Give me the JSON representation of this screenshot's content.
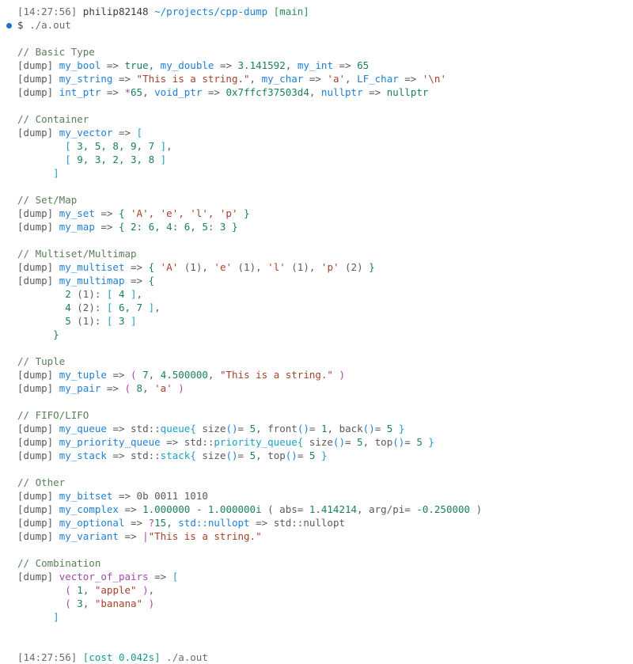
{
  "terminal": {
    "title": "terminal-session",
    "background": "#ffffff",
    "prompt": {
      "marker": "prompt-bullet",
      "marker_color": "#1a73c8",
      "timestamp": "[14:27:56]",
      "user": "philip82148",
      "path": "~/projects/cpp-dump",
      "branch": "[main]",
      "symbol": "$",
      "command": "./a.out"
    },
    "footer": {
      "timestamp": "[14:27:56]",
      "cost": "[cost 0.042s]",
      "command": "./a.out"
    },
    "sections": [
      {
        "comment": "// Basic Type",
        "lines": [
          "[dump] my_bool => true, my_double => 3.141592, my_int => 65",
          "[dump] my_string => \"This is a string.\", my_char => 'a', LF_char => '\\n'",
          "[dump] int_ptr => *65, void_ptr => 0x7ffcf37503d4, nullptr => nullptr"
        ]
      },
      {
        "comment": "// Container",
        "lines": [
          "[dump] my_vector => [",
          "        [ 3, 5, 8, 9, 7 ],",
          "        [ 9, 3, 2, 3, 8 ]",
          "      ]"
        ]
      },
      {
        "comment": "// Set/Map",
        "lines": [
          "[dump] my_set => { 'A', 'e', 'l', 'p' }",
          "[dump] my_map => { 2: 6, 4: 6, 5: 3 }"
        ]
      },
      {
        "comment": "// Multiset/Multimap",
        "lines": [
          "[dump] my_multiset => { 'A' (1), 'e' (1), 'l' (1), 'p' (2) }",
          "[dump] my_multimap => {",
          "        2 (1): [ 4 ],",
          "        4 (2): [ 6, 7 ],",
          "        5 (1): [ 3 ]",
          "      }"
        ]
      },
      {
        "comment": "// Tuple",
        "lines": [
          "[dump] my_tuple => ( 7, 4.500000, \"This is a string.\" )",
          "[dump] my_pair => ( 8, 'a' )"
        ]
      },
      {
        "comment": "// FIFO/LIFO",
        "lines": [
          "[dump] my_queue => std::queue{ size()= 5, front()= 1, back()= 5 }",
          "[dump] my_priority_queue => std::priority_queue{ size()= 5, top()= 5 }",
          "[dump] my_stack => std::stack{ size()= 5, top()= 5 }"
        ]
      },
      {
        "comment": "// Other",
        "lines": [
          "[dump] my_bitset => 0b 0011 1010",
          "[dump] my_complex => 1.000000 - 1.000000i ( abs= 1.414214, arg/pi= -0.250000 )",
          "[dump] my_optional => ?15, std::nullopt => std::nullopt",
          "[dump] my_variant => |\"This is a string.\""
        ]
      },
      {
        "comment": "// Combination",
        "lines": [
          "[dump] vector_of_pairs => [",
          "        ( 1, \"apple\" ),",
          "        ( 3, \"banana\" )",
          "      ]"
        ]
      }
    ],
    "tokens": {
      "dump_tag": "[dump]",
      "arrow": "=>",
      "var_my_bool": "my_bool",
      "val_true": "true",
      "var_my_double": "my_double",
      "val_pi": "3.141592",
      "var_my_int": "my_int",
      "val_65": "65",
      "var_my_string": "my_string",
      "val_string": "\"This is a string.\"",
      "var_my_char": "my_char",
      "val_char_a": "'a'",
      "var_lf_char": "LF_char",
      "val_char_lf": "'\\n'",
      "var_int_ptr": "int_ptr",
      "val_star65": "*65",
      "var_void_ptr": "void_ptr",
      "val_addr": "0x7ffcf37503d4",
      "var_nullptr": "nullptr",
      "val_nullptr": "nullptr",
      "var_my_vector": "my_vector",
      "vec_row1": "[ 3, 5, 8, 9, 7 ],",
      "vec_row2": "[ 9, 3, 2, 3, 8 ]",
      "var_my_set": "my_set",
      "set_body": "{ 'A', 'e', 'l', 'p' }",
      "var_my_map": "my_map",
      "map_body": "{ 2: 6, 4: 6, 5: 3 }",
      "var_my_multiset": "my_multiset",
      "multiset_body": "{ 'A' (1), 'e' (1), 'l' (1), 'p' (2) }",
      "var_my_multimap": "my_multimap",
      "mm_row1": "2 (1): [ 4 ],",
      "mm_row2": "4 (2): [ 6, 7 ],",
      "mm_row3": "5 (1): [ 3 ]",
      "var_my_tuple": "my_tuple",
      "tuple_body": "( 7, 4.500000, \"This is a string.\" )",
      "var_my_pair": "my_pair",
      "pair_body": "( 8, 'a' )",
      "var_my_queue": "my_queue",
      "queue_body": "std::queue{ size()= 5, front()= 1, back()= 5 }",
      "var_my_priority_queue": "my_priority_queue",
      "pq_body": "std::priority_queue{ size()= 5, top()= 5 }",
      "var_my_stack": "my_stack",
      "stack_body": "std::stack{ size()= 5, top()= 5 }",
      "var_my_bitset": "my_bitset",
      "bitset_body": "0b 0011 1010",
      "var_my_complex": "my_complex",
      "var_my_optional": "my_optional",
      "var_std_nullopt": "std::nullopt",
      "var_my_variant": "my_variant",
      "var_vector_of_pairs": "vector_of_pairs",
      "pair_row1": "( 1, \"apple\" ),",
      "pair_row2": "( 3, \"banana\" )"
    }
  }
}
